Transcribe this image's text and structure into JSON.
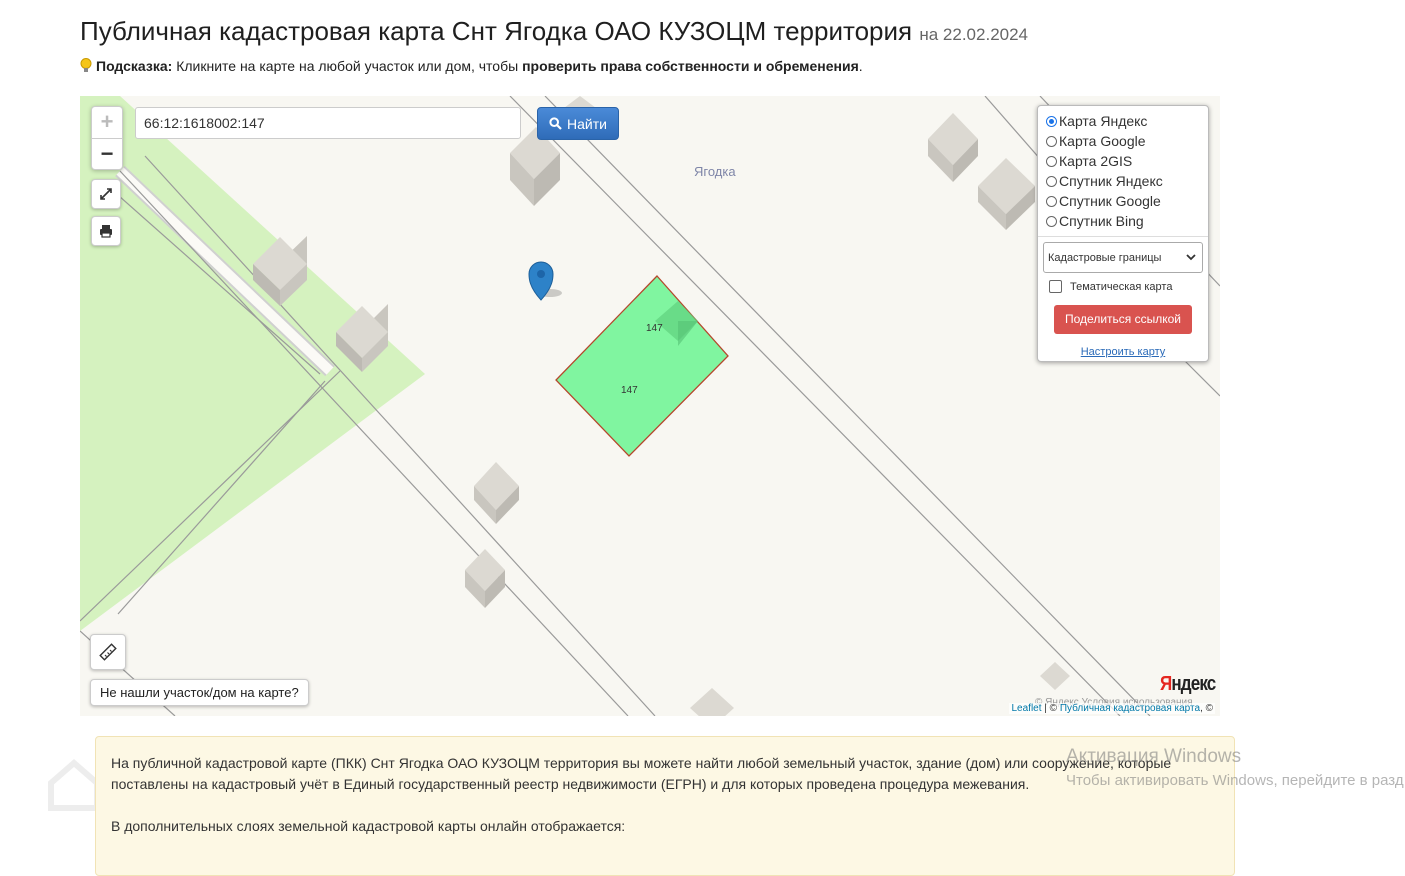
{
  "page": {
    "title": "Публичная кадастровая карта Снт Ягодка ОАО КУЗОЦМ территория",
    "date": "на 22.02.2024",
    "hint_label": "Подсказка:",
    "hint_text": "Кликните на карте на любой участок или дом, чтобы",
    "hint_bold": "проверить права собственности и обременения",
    "hint_end": "."
  },
  "map": {
    "search_value": "66:12:1618002:147",
    "search_button": "Найти",
    "zoom_in": "+",
    "zoom_out": "−",
    "place_label": "Ягодка",
    "parcel_labels": [
      "147",
      "147"
    ],
    "not_found_button": "Не нашли участок/дом на карте?",
    "yandex_logo_first": "Я",
    "yandex_logo_rest": "ндекс",
    "yandex_terms": "© Яндекс  Условия использования",
    "attribution": {
      "leaflet": "Leaflet",
      "sep": " | © ",
      "pkk": "Публичная кадастровая карта",
      "end": ", ©"
    },
    "parcel_color": "#80f5a0",
    "parcel_border": "#b5472c"
  },
  "layers": {
    "options": [
      {
        "label": "Карта Яндекс",
        "selected": true
      },
      {
        "label": "Карта Google",
        "selected": false
      },
      {
        "label": "Карта 2GIS",
        "selected": false
      },
      {
        "label": "Спутник Яндекс",
        "selected": false
      },
      {
        "label": "Спутник Google",
        "selected": false
      },
      {
        "label": "Спутник Bing",
        "selected": false
      }
    ],
    "select_value": "Кадастровые границы",
    "thematic_label": "Тематическая карта",
    "share_button": "Поделиться ссылкой",
    "setup_link": "Настроить карту"
  },
  "info": {
    "p1": "На публичной кадастровой карте (ПКК) Снт Ягодка ОАО КУЗОЦМ территория вы можете найти любой земельный участок, здание (дом) или сооружение, которые поставлены на кадастровый учёт в Единый государственный реестр недвижимости (ЕГРН) и для которых проведена процедура межевания.",
    "p2": "В дополнительных слоях земельной кадастровой карты онлайн отображается:"
  },
  "windows": {
    "line1": "Активация Windows",
    "line2": "Чтобы активировать Windows, перейдите в разд"
  }
}
